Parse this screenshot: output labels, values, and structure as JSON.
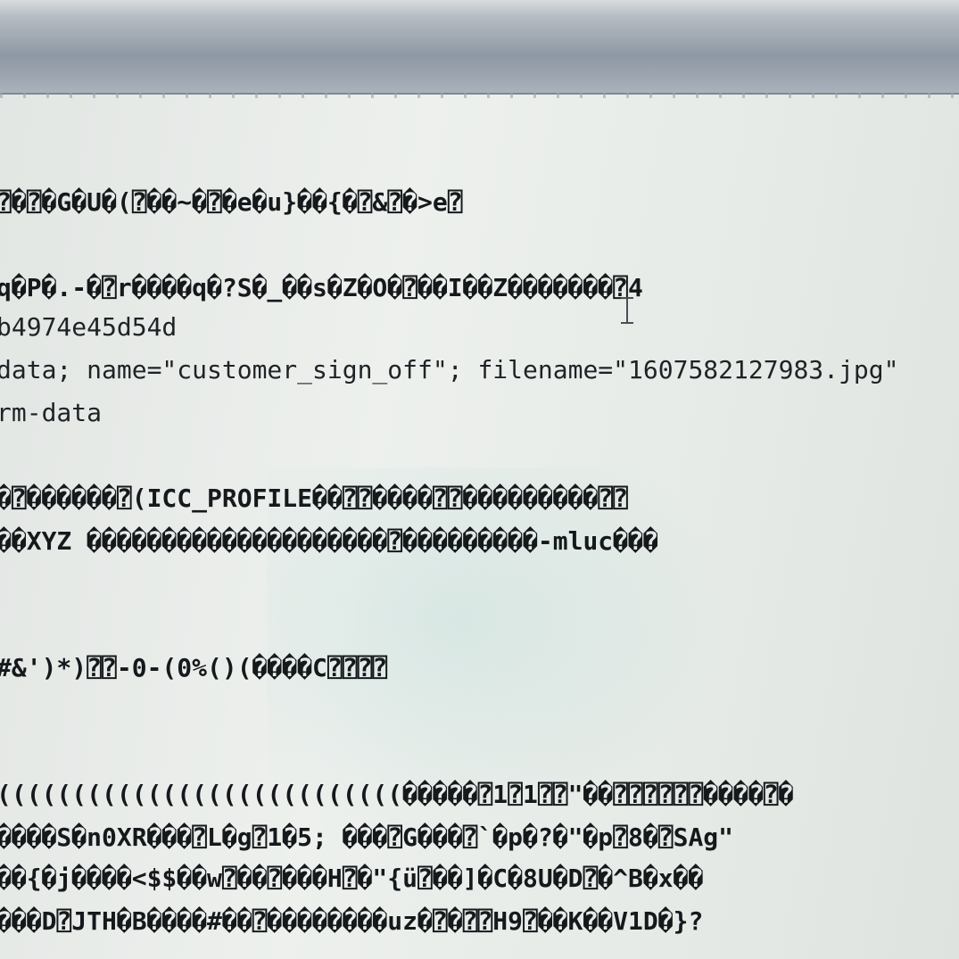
{
  "editor": {
    "lines": [
      "⍰�⍰�G�U�(⍰��~�⍰�e�u}��{�⍰&⍰�>e⍰",
      "q�P�.-�⍰r����q�?S�_��s�Z�O�⍰��I��Z�������⍰4",
      "b4974e45d54d",
      "data; name=\"customer_sign_off\"; filename=\"1607582127983.jpg\"",
      "rm-data",
      "�⍰������⍰(ICC_PROFILE��⍰⍰����⍰⍰���������⍰⍰",
      "��XYZ ��������������������⍰���������-mluc���",
      "#&')*)⍰⍰-0-(0%()(����C⍰⍰⍰⍰",
      "(((((((((((((((((((((((((((�����⍰1⍰1⍰⍰\"��⍰⍰⍰⍰⍰⍰����⍰�",
      "����S�n0XR���⍰L�g⍰1�5; ���⍰G���⍰`�p�?�\"�p⍰8�⍰SAg\"",
      "��{�j����<$$��w⍰��⍰���H⍰�\"{ü⍰��]�C�8U�D⍰�^B�x��",
      "���D⍰JTH�B����#��⍰��������uz�⍰�⍰⍰H9⍰��K��V1D�}?"
    ]
  },
  "cursor": {
    "icon": "text-ibeam-cursor-icon"
  }
}
